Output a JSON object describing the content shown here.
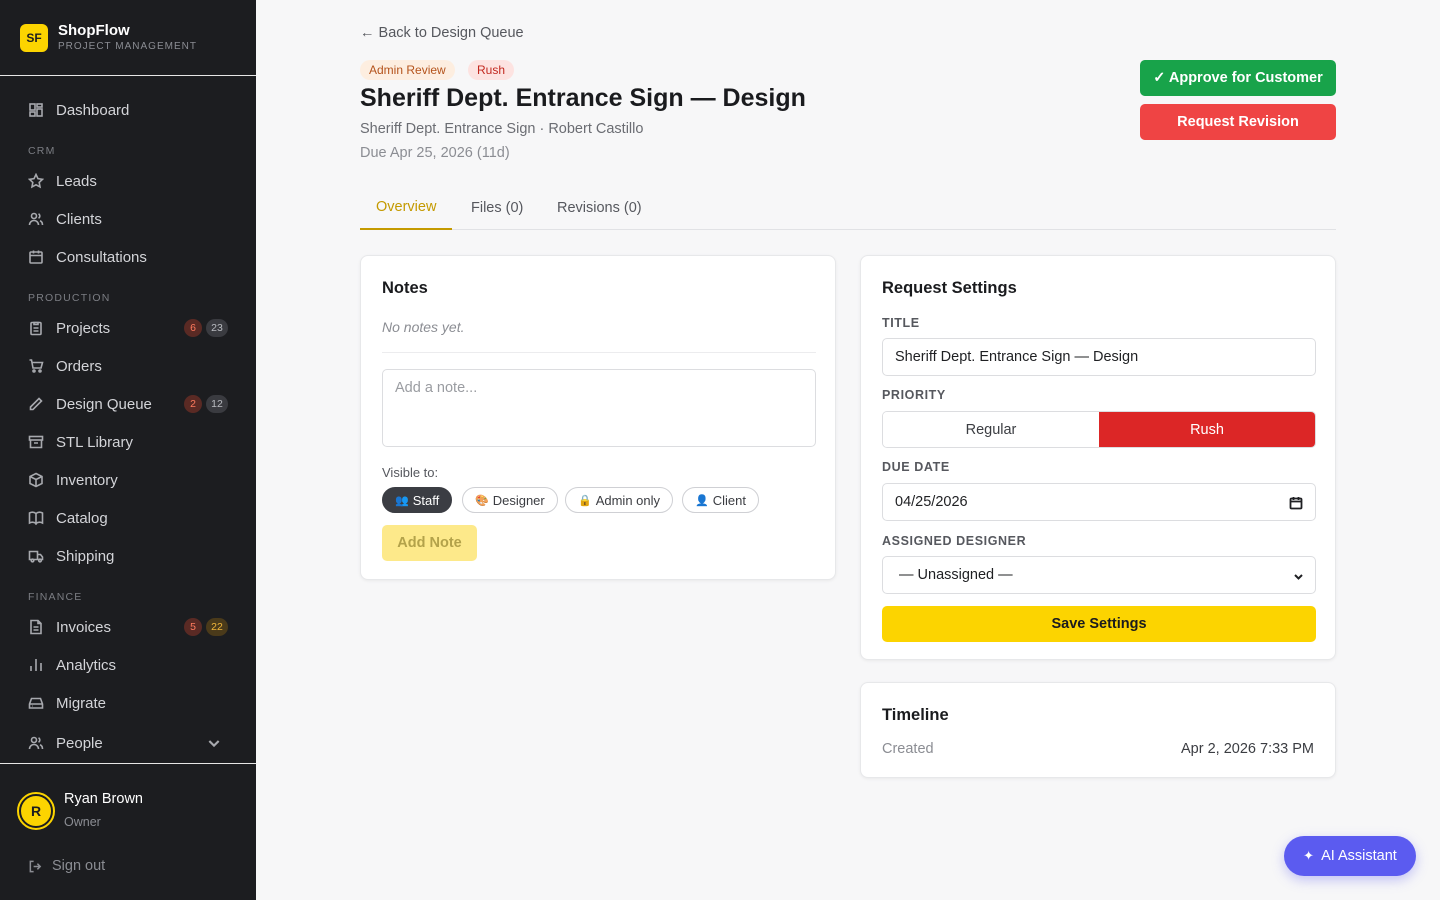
{
  "brand": {
    "logo": "SF",
    "name": "ShopFlow",
    "subtitle": "PROJECT MANAGEMENT"
  },
  "sidebar": {
    "dashboard": "Dashboard",
    "section_crm": "CRM",
    "leads": "Leads",
    "clients": "Clients",
    "consultations": "Consultations",
    "section_production": "PRODUCTION",
    "projects": "Projects",
    "projects_badge_alert": "6",
    "projects_badge_total": "23",
    "orders": "Orders",
    "design_queue": "Design Queue",
    "design_badge_alert": "2",
    "design_badge_total": "12",
    "stl_library": "STL Library",
    "inventory": "Inventory",
    "catalog": "Catalog",
    "shipping": "Shipping",
    "section_finance": "FINANCE",
    "invoices": "Invoices",
    "invoices_badge_alert": "5",
    "invoices_badge_total": "22",
    "analytics": "Analytics",
    "migrate": "Migrate",
    "people": "People"
  },
  "user": {
    "initial": "R",
    "name": "Ryan Brown",
    "role": "Owner",
    "signout": "Sign out"
  },
  "header": {
    "back": "← Back to Design Queue",
    "tag_status": "Admin Review",
    "tag_priority": "Rush",
    "title": "Sheriff Dept. Entrance Sign — Design",
    "subtitle": "Sheriff Dept. Entrance Sign · Robert Castillo",
    "due": "Due Apr 25, 2026 (11d)",
    "approve": "✓ Approve for Customer",
    "revision": "Request Revision"
  },
  "tabs": {
    "overview": "Overview",
    "files": "Files (0)",
    "revisions": "Revisions (0)"
  },
  "notes": {
    "title": "Notes",
    "empty": "No notes yet.",
    "placeholder": "Add a note...",
    "visible_label": "Visible to:",
    "opt_staff": "Staff",
    "opt_designer": "Designer",
    "opt_admin": "Admin only",
    "opt_client": "Client",
    "add": "Add Note"
  },
  "settings": {
    "title": "Request Settings",
    "title_label": "TITLE",
    "title_value": "Sheriff Dept. Entrance Sign — Design",
    "priority_label": "PRIORITY",
    "priority_regular": "Regular",
    "priority_rush": "Rush",
    "due_label": "DUE DATE",
    "due_value": "04/25/2026",
    "designer_label": "ASSIGNED DESIGNER",
    "designer_value": "— Unassigned —",
    "save": "Save Settings"
  },
  "timeline": {
    "title": "Timeline",
    "created_label": "Created",
    "created_value": "Apr 2, 2026 7:33 PM"
  },
  "ai": {
    "label": "AI Assistant"
  },
  "colors": {
    "accent": "#fcd400",
    "approve": "#18a34a",
    "revision": "#ef4444",
    "rush": "#dc2626",
    "ai": "#5b5bf0",
    "sidebar": "#1c1d20"
  }
}
